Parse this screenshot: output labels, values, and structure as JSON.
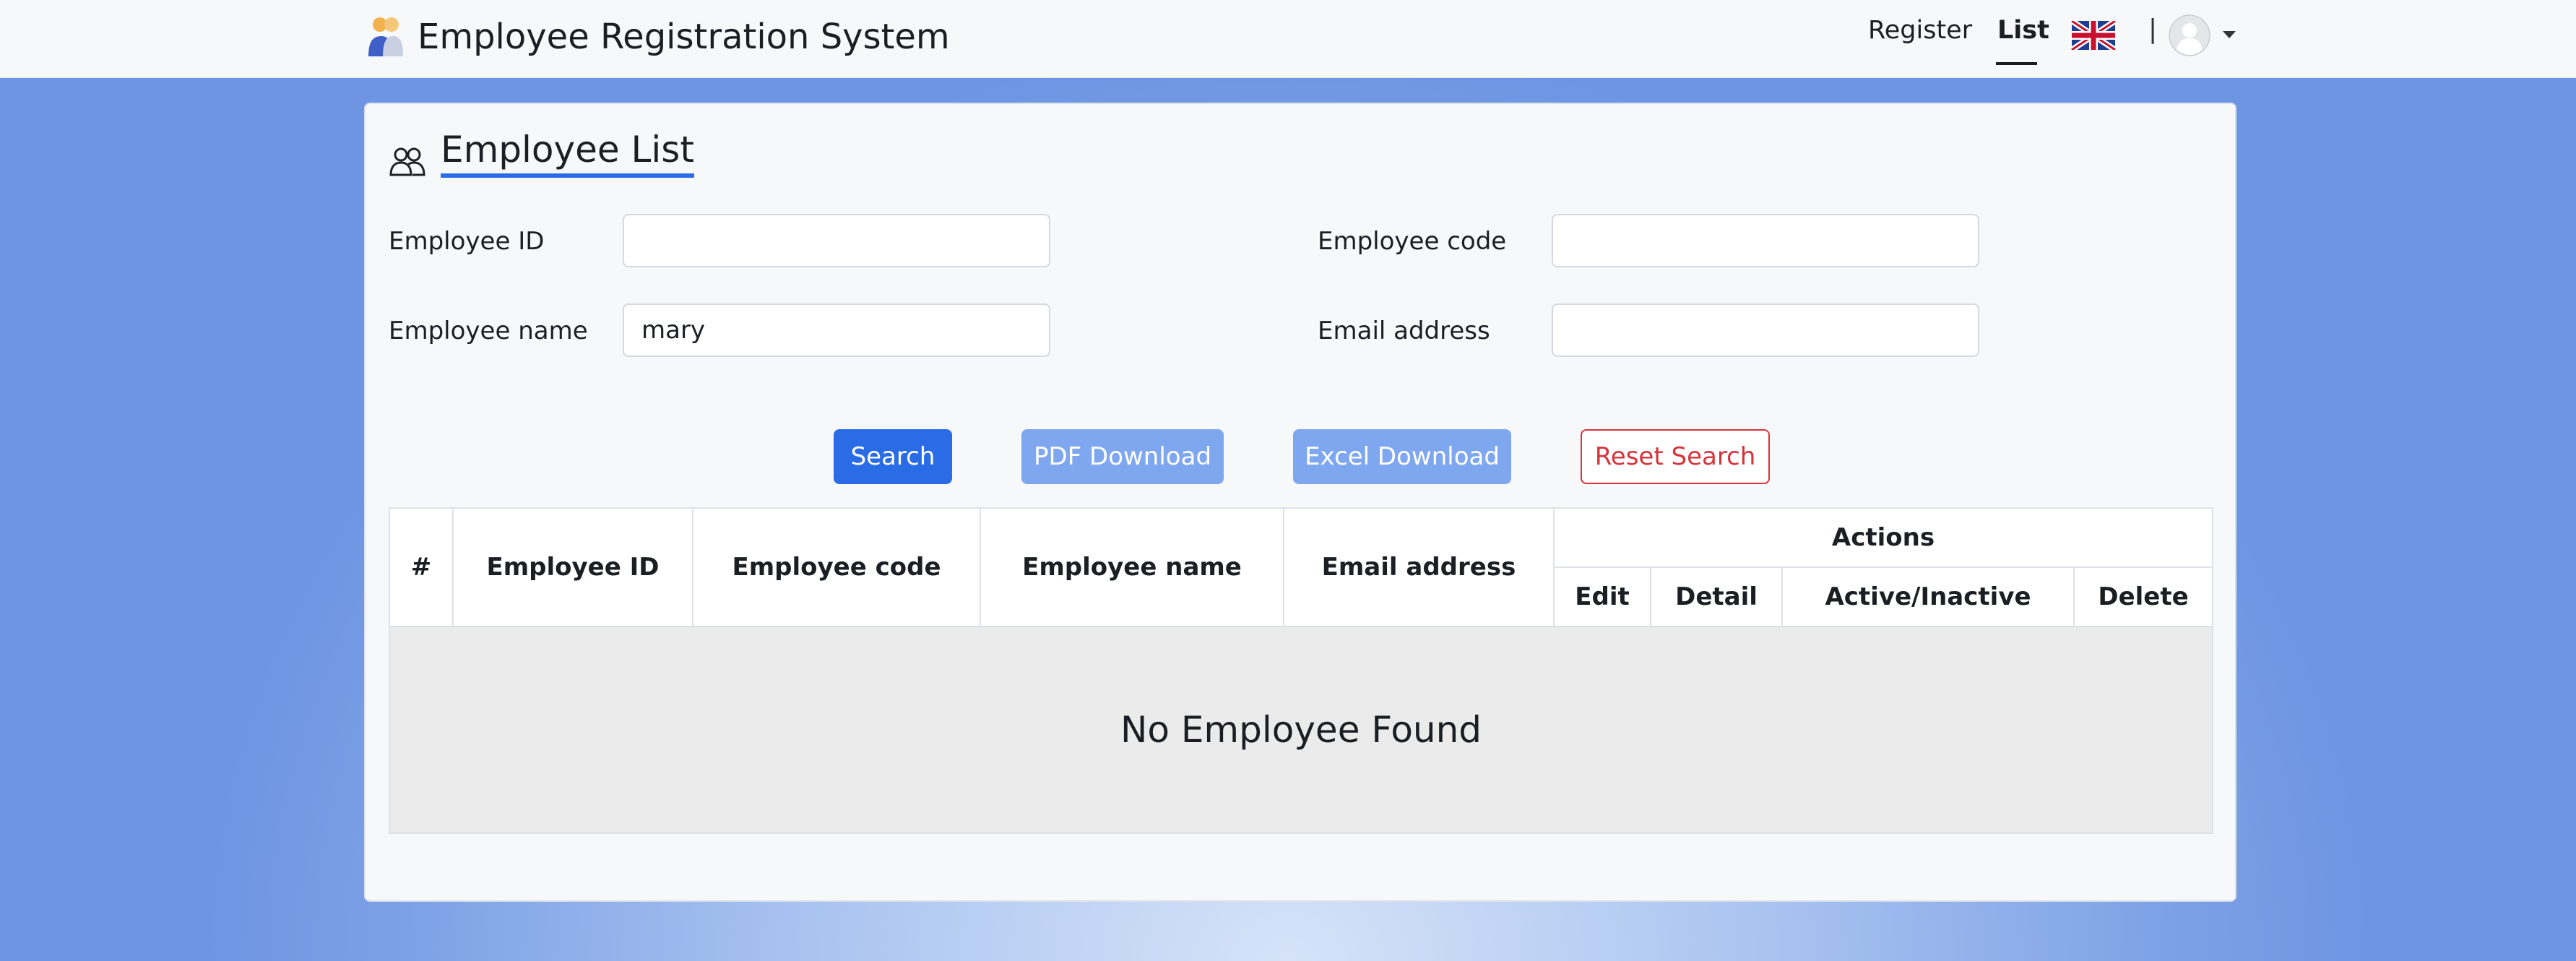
{
  "header": {
    "app_title": "Employee Registration System",
    "nav": {
      "register": "Register",
      "list": "List"
    },
    "divider": "|",
    "language_icon": "uk-flag-icon",
    "user_icon": "user-avatar-icon"
  },
  "page": {
    "title": "Employee List",
    "title_icon": "people-icon"
  },
  "search_form": {
    "employee_id": {
      "label": "Employee ID",
      "value": "",
      "placeholder": ""
    },
    "employee_code": {
      "label": "Employee code",
      "value": "",
      "placeholder": ""
    },
    "employee_name": {
      "label": "Employee name",
      "value": "mary",
      "placeholder": ""
    },
    "email_address": {
      "label": "Email address",
      "value": "",
      "placeholder": ""
    }
  },
  "buttons": {
    "search": "Search",
    "pdf_download": "PDF Download",
    "excel_download": "Excel Download",
    "reset_search": "Reset Search"
  },
  "table": {
    "columns": [
      "#",
      "Employee ID",
      "Employee code",
      "Employee name",
      "Email address"
    ],
    "actions_header": "Actions",
    "action_columns": [
      "Edit",
      "Detail",
      "Active/Inactive",
      "Delete"
    ],
    "rows": [],
    "empty_message": "No Employee Found"
  },
  "colors": {
    "primary": "#2a6ce6",
    "primary_light": "#7ea7f0",
    "danger": "#d6333b",
    "background": "#739ae3"
  }
}
